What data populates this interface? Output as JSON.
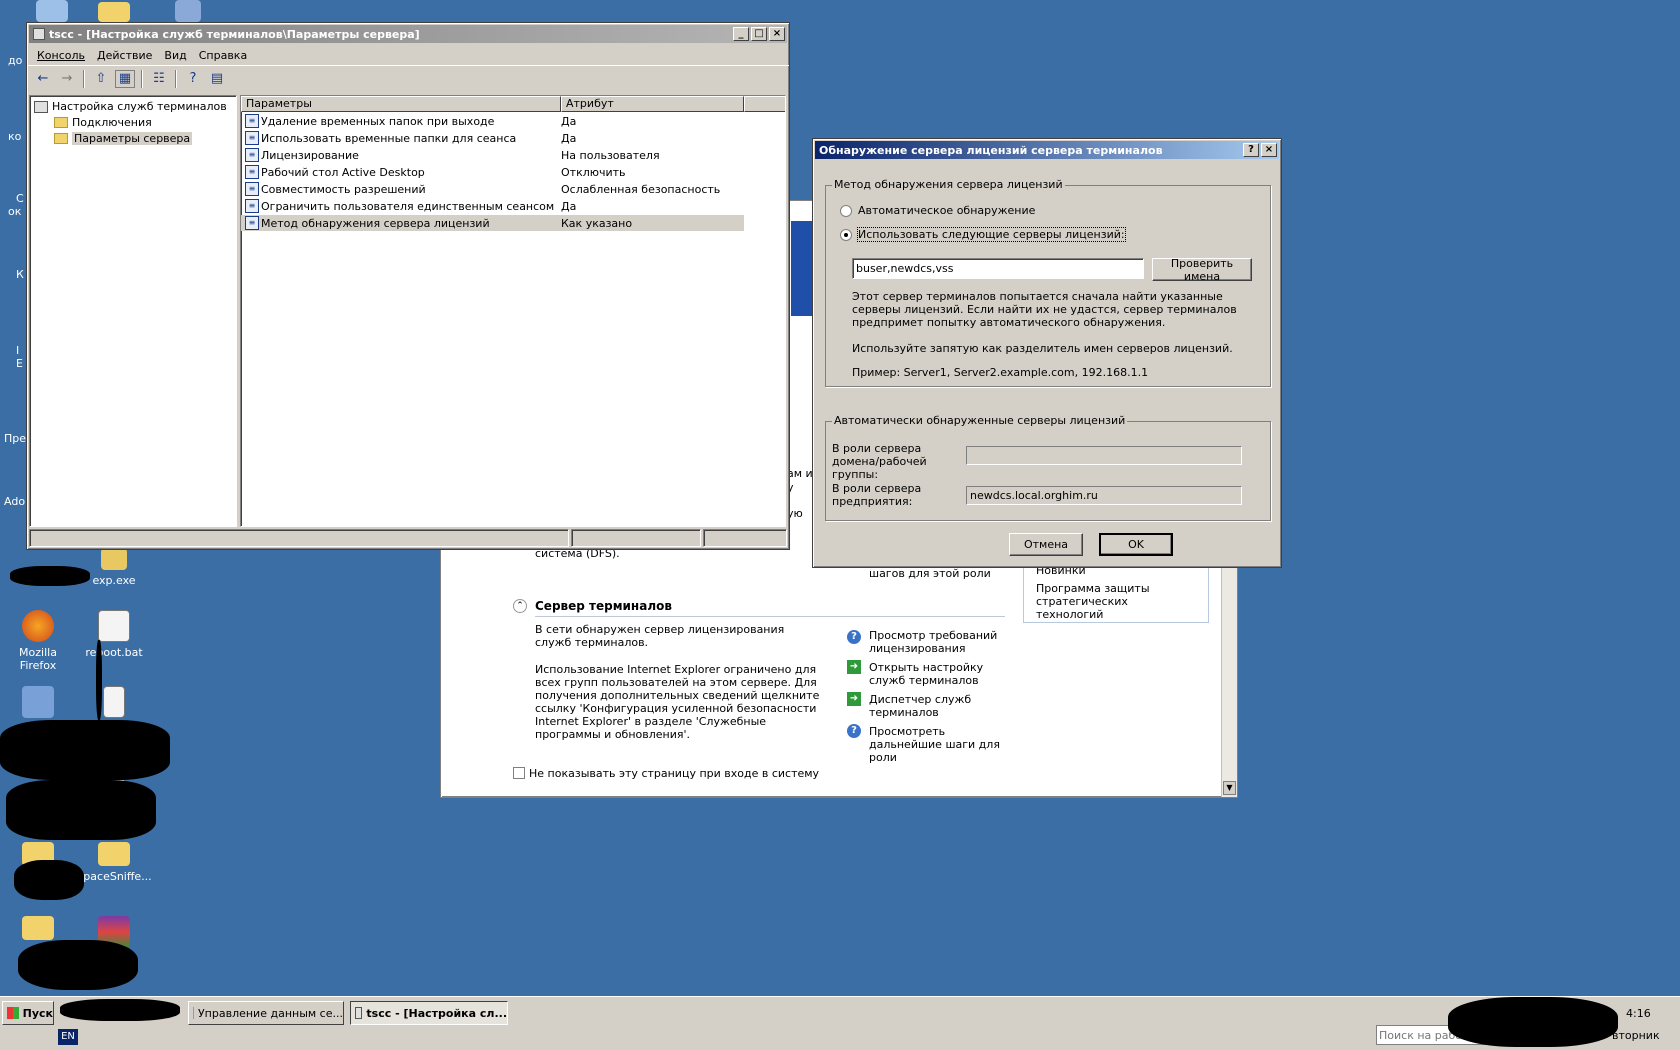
{
  "desktop": {
    "left_fragments": [
      "до",
      "ко",
      "С",
      "ок",
      "К",
      "I",
      "Е",
      "Пре",
      "Ado"
    ],
    "icons": [
      {
        "label": "exp.exe"
      },
      {
        "label": "Mozilla Firefox"
      },
      {
        "label": "reboot.bat"
      },
      {
        "label": "SpaceSniffe..."
      }
    ]
  },
  "mmc": {
    "title": "tscc - [Настройка служб терминалов\\Параметры сервера]",
    "menu": [
      "Консоль",
      "Действие",
      "Вид",
      "Справка"
    ],
    "tree": {
      "root": "Настройка служб терминалов",
      "children": [
        "Подключения",
        "Параметры сервера"
      ]
    },
    "columns": [
      "Параметры",
      "Атрибут"
    ],
    "rows": [
      {
        "param": "Удаление временных папок при выходе",
        "attr": "Да"
      },
      {
        "param": "Использовать временные папки для сеанса",
        "attr": "Да"
      },
      {
        "param": "Лицензирование",
        "attr": "На пользователя"
      },
      {
        "param": "Рабочий стол Active Desktop",
        "attr": "Отключить"
      },
      {
        "param": "Совместимость разрешений",
        "attr": "Ослабленная безопасность"
      },
      {
        "param": "Ограничить пользователя единственным сеансом",
        "attr": "Да"
      },
      {
        "param": "Метод обнаружения сервера лицензий",
        "attr": "Как указано"
      }
    ]
  },
  "dialog": {
    "title": "Обнаружение сервера лицензий сервера терминалов",
    "group1_label": "Метод обнаружения сервера лицензий",
    "radio_auto": "Автоматическое обнаружение",
    "radio_manual": "Использовать следующие серверы лицензий:",
    "servers_value": "buser,newdcs,vss",
    "check_names_button": "Проверить имена",
    "info1": "Этот сервер терминалов попытается сначала найти указанные серверы лицензий. Если найти их не удастся, сервер терминалов предпримет попытку автоматического обнаружения.",
    "info2": "Используйте запятую как разделитель имен серверов лицензий.",
    "info3": "Пример: Server1, Server2.example.com, 192.168.1.1",
    "group2_label": "Автоматически обнаруженные серверы лицензий",
    "domain_role_label": "В роли сервера домена/рабочей группы:",
    "domain_role_value": "",
    "enterprise_role_label": "В роли сервера предприятия:",
    "enterprise_role_value": "newdcs.local.orghim.ru",
    "cancel": "Отмена",
    "ok": "OK"
  },
  "manage": {
    "frag_right1": "ам и",
    "frag_right2": "у",
    "frag_right3": "ую",
    "frag_dfs": "система (DFS).",
    "frag_steps": "шагов для этой роли",
    "frag_news": "Новинки",
    "frag_protect": "Программа защиты стратегических технологий",
    "section_title": "Сервер терминалов",
    "para1": "В сети обнаружен сервер лицензирования служб терминалов.",
    "para2": "Использование Internet Explorer ограничено для всех групп пользователей на этом сервере. Для получения дополнительных сведений щелкните ссылку 'Конфигурация усиленной безопасности Internet Explorer' в разделе 'Служебные программы и обновления'.",
    "links": [
      "Просмотр требований лицензирования",
      "Открыть настройку служб терминалов",
      "Диспетчер служб терминалов",
      "Просмотреть дальнейшие шаги для роли"
    ],
    "dont_show": "Не показывать эту страницу при входе в систему"
  },
  "taskbar": {
    "start": "Пуск",
    "tasks": [
      "Управление данным се...",
      "tscc - [Настройка сл..."
    ],
    "search_placeholder": "Поиск на рабочем ст",
    "lang": "EN",
    "time": "4:16",
    "day": "вторник"
  }
}
